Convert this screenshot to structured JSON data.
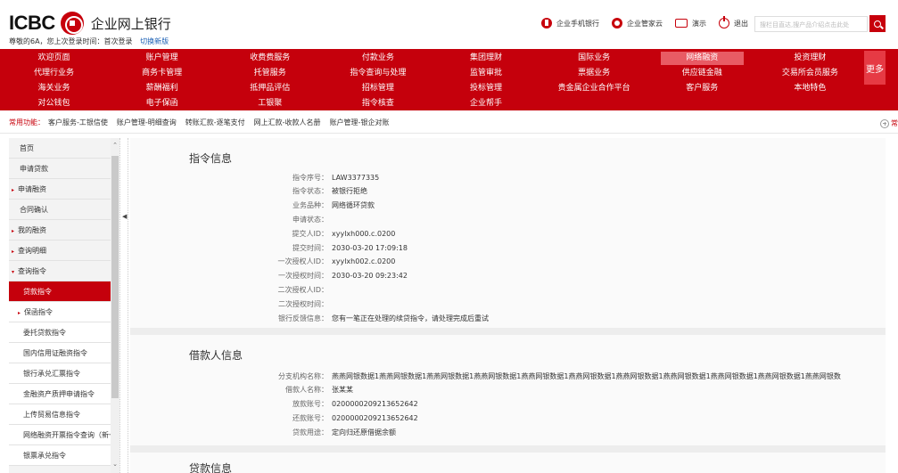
{
  "header": {
    "logo_text": "ICBC",
    "bank_name": "企业网上银行",
    "welcome": "尊敬的6A，您上次登录时间：首次登录",
    "switch_link": "切换新版",
    "links": [
      {
        "icon": "phone-icon",
        "label": "企业手机银行"
      },
      {
        "icon": "cloud-icon",
        "label": "企业管家云"
      },
      {
        "icon": "demo-icon",
        "label": "演示"
      },
      {
        "icon": "exit-icon",
        "label": "退出"
      }
    ],
    "search_placeholder": "搜栏目直达,搜产品介绍点击此处"
  },
  "nav": {
    "rows": [
      [
        "欢迎页面",
        "账户管理",
        "收费费服务",
        "付款业务",
        "集团理财",
        "国际业务",
        "网络融资",
        "投资理财"
      ],
      [
        "代理行业务",
        "商务卡管理",
        "托管服务",
        "指令查询与处理",
        "监管审批",
        "票据业务",
        "供应链金融",
        "交易所会员服务"
      ],
      [
        "海关业务",
        "薪酬福利",
        "抵押品评估",
        "招标管理",
        "投标管理",
        "贵金属企业合作平台",
        "客户服务",
        "本地特色"
      ],
      [
        "对公钱包",
        "电子保函",
        "工银聚",
        "指令核查",
        "企业帮手",
        "",
        "",
        ""
      ]
    ],
    "active": "网络融资",
    "more": "更多"
  },
  "quick": {
    "label": "常用功能：",
    "items": [
      "客户服务-工银信使",
      "账户管理-明细查询",
      "转账汇款-逐笔支付",
      "网上汇款-收款人名册",
      "账户管理-银企对账"
    ],
    "tail": "常"
  },
  "sidebar": {
    "items": [
      {
        "label": "首页",
        "type": "top"
      },
      {
        "label": "申请贷款",
        "type": "top"
      },
      {
        "label": "申请融资",
        "type": "group"
      },
      {
        "label": "合同确认",
        "type": "top"
      },
      {
        "label": "我的融资",
        "type": "group"
      },
      {
        "label": "查询明细",
        "type": "group"
      },
      {
        "label": "查询指令",
        "type": "group-open"
      },
      {
        "label": "贷款指令",
        "type": "active"
      },
      {
        "label": "保函指令",
        "type": "sub-arrow"
      },
      {
        "label": "委托贷款指令",
        "type": "sub"
      },
      {
        "label": "国内信用证融资指令",
        "type": "sub"
      },
      {
        "label": "银行承兑汇票指令",
        "type": "sub"
      },
      {
        "label": "金融资产质押申请指令",
        "type": "sub"
      },
      {
        "label": "上传贸易信息指令",
        "type": "sub"
      },
      {
        "label": "网络融资开票指令查询（新一",
        "type": "sub"
      },
      {
        "label": "银票承兑指令",
        "type": "sub"
      }
    ]
  },
  "instruction": {
    "title": "指令信息",
    "fields": [
      {
        "label": "指令序号：",
        "value": "LAW3377335"
      },
      {
        "label": "指令状态：",
        "value": "被银行拒绝"
      },
      {
        "label": "业务品种：",
        "value": "网络循环贷款"
      },
      {
        "label": "申请状态：",
        "value": ""
      },
      {
        "label": "提交人ID：",
        "value": "xyylxh000.c.0200"
      },
      {
        "label": "提交时间：",
        "value": "2030-03-20 17:09:18"
      },
      {
        "label": "一次授权人ID：",
        "value": "xyylxh002.c.0200"
      },
      {
        "label": "一次授权时间：",
        "value": "2030-03-20 09:23:42"
      },
      {
        "label": "二次授权人ID：",
        "value": ""
      },
      {
        "label": "二次授权时间：",
        "value": ""
      },
      {
        "label": "银行反馈信息：",
        "value": "您有一笔正在处理的续贷指令，请处理完成后重试"
      }
    ]
  },
  "borrower": {
    "title": "借款人信息",
    "fields": [
      {
        "label": "分支机构名称：",
        "value": "燕燕网银数据1燕燕网银数据1燕燕网银数据1燕燕网银数据1燕燕网银数据1燕燕网银数据1燕燕网银数据1燕燕网银数据1燕燕网银数据1燕燕网银数据1燕燕网银数"
      },
      {
        "label": "借款人名称：",
        "value": "张某某"
      },
      {
        "label": "放款账号：",
        "value": "0200000209213652642"
      },
      {
        "label": "还款账号：",
        "value": "0200000209213652642"
      },
      {
        "label": "贷款用途：",
        "value": "定向归还原借据余额"
      }
    ]
  },
  "loan": {
    "title": "贷款信息"
  },
  "colors": {
    "brand_red": "#c5000c",
    "active_nav": "#e85b64"
  }
}
